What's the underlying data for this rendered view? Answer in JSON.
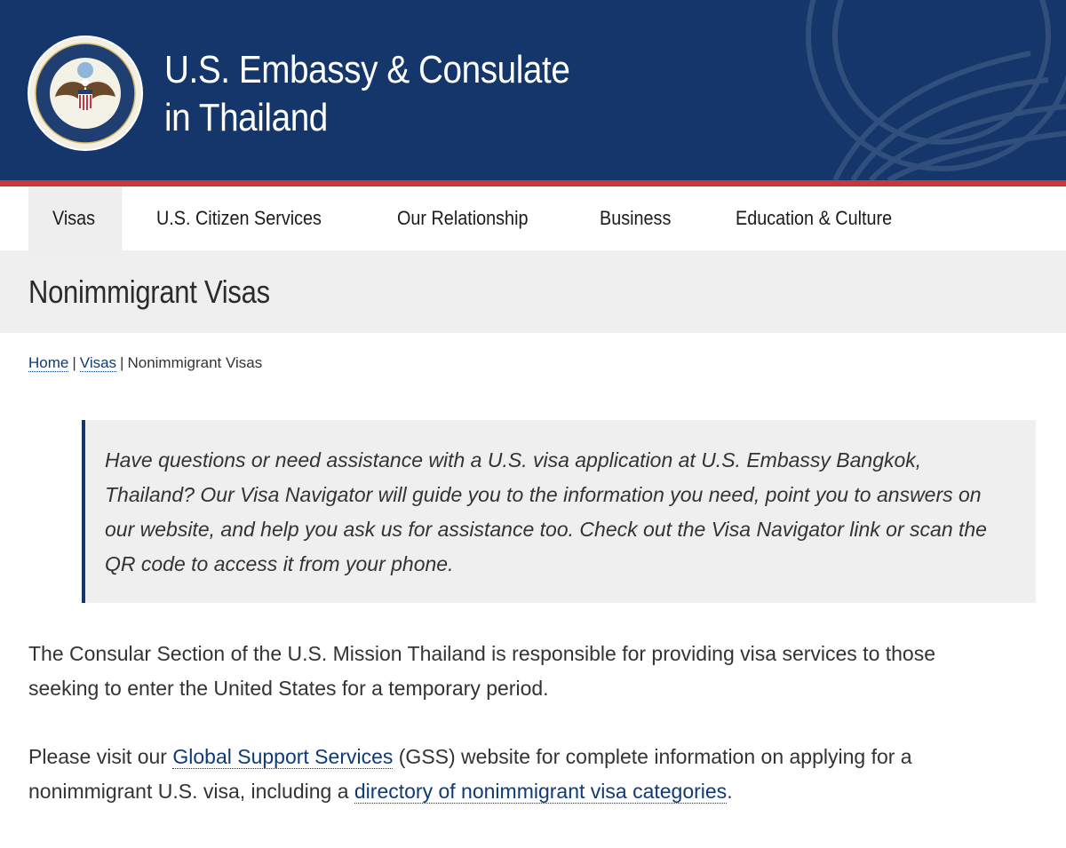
{
  "header": {
    "title_line1": "U.S. Embassy & Consulate",
    "title_line2": "in Thailand",
    "seal_text": "DEPARTMENT OF STATE · UNITED STATES OF AMERICA",
    "colors": {
      "header_bg": "#14366b",
      "accent_red": "#c7383a"
    }
  },
  "nav": {
    "items": [
      {
        "label": "Visas",
        "active": true
      },
      {
        "label": "U.S. Citizen Services"
      },
      {
        "label": "Our Relationship"
      },
      {
        "label": "Business"
      },
      {
        "label": "Education & Culture"
      }
    ]
  },
  "page": {
    "title": "Nonimmigrant Visas"
  },
  "breadcrumb": {
    "home": "Home",
    "visas": "Visas",
    "current": "Nonimmigrant Visas",
    "separator": "|"
  },
  "callout": {
    "part1": "Have questions or need assistance with a U.S. visa application at U.S. Embassy Bangkok, Thailand? Our ",
    "link1": "Visa Navigator",
    "part2": " will guide you to the information you need, point you to answers on our website, and help you ask us for assistance too.  Check out the ",
    "link2": "Visa Navigator",
    "part3": " link or scan the ",
    "link3": "QR code",
    "part4": " to access it from your phone."
  },
  "body": {
    "para1": "The Consular Section of the U.S. Mission Thailand is responsible for providing visa services to those seeking to enter the United States for a temporary period.",
    "para2_part1": "Please visit our ",
    "para2_link1": "Global Support Services",
    "para2_part2": " (GSS) website for complete information on applying for a nonimmigrant U.S. visa, including a ",
    "para2_link2": "directory of nonimmigrant visa categories",
    "para2_part3": "."
  }
}
